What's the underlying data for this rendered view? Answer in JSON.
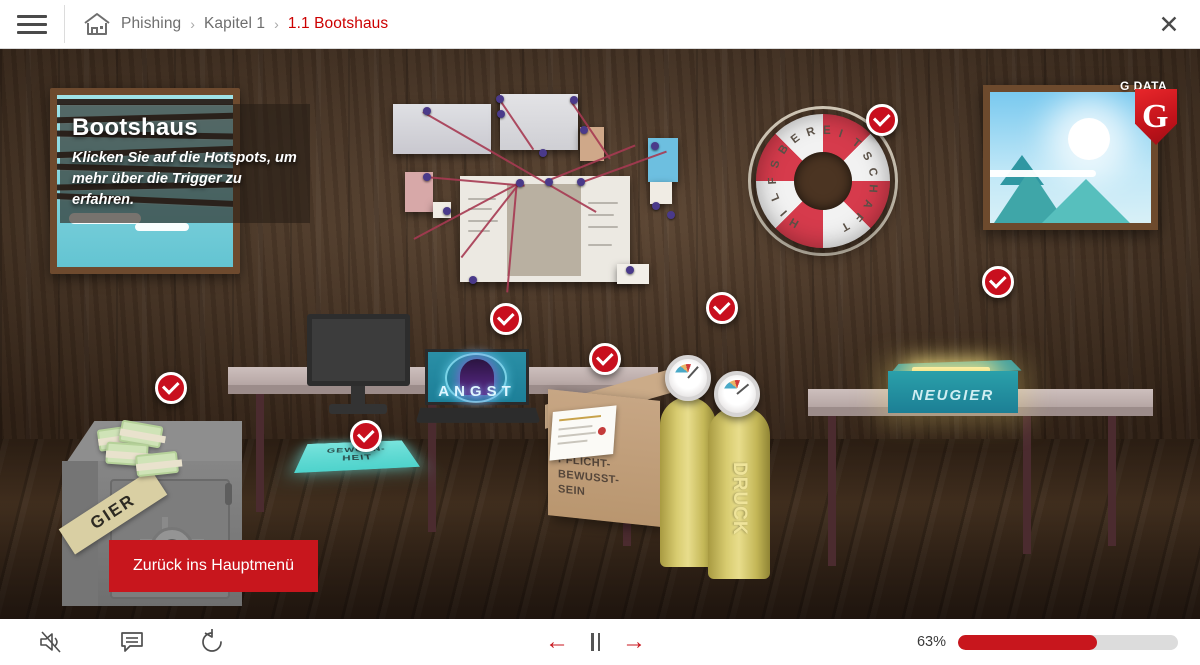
{
  "header": {
    "menu_icon": "hamburger-icon",
    "home_icon": "home-icon",
    "close_icon": "close-icon",
    "breadcrumbs": [
      {
        "label": "Phishing",
        "active": false
      },
      {
        "label": "Kapitel 1",
        "active": false
      },
      {
        "label": "1.1 Bootshaus",
        "active": true
      }
    ],
    "separator": "›"
  },
  "scene": {
    "title_card": {
      "title": "Bootshaus",
      "subtitle": "Klicken Sie auf die Hotspots, um mehr über die Trigger zu erfahren."
    },
    "brand": {
      "word": "G DATA",
      "letter": "G"
    },
    "hotspot_icon": "check-icon",
    "labels": {
      "safe": "GIER",
      "laptop": "ANGST",
      "sticky_line1": "GEWOHN-",
      "sticky_line2": "HEIT",
      "banner_line1": "PFLICHT-",
      "banner_line2": "BEWUSST-",
      "banner_line3": "SEIN",
      "cylinder": "DRUCK",
      "box": "NEUGIER",
      "lifebuoy": "HILFSBEREITSCHAFT"
    },
    "menu_button": "Zurück ins Hauptmenü"
  },
  "footer": {
    "mute_icon": "speaker-muted-icon",
    "transcript_icon": "transcript-icon",
    "replay_icon": "replay-icon",
    "prev_icon": "arrow-left-icon",
    "pause_icon": "pause-icon",
    "next_icon": "arrow-right-icon",
    "progress_label": "63%",
    "progress_value": 63
  },
  "colors": {
    "accent_red": "#c8161d",
    "crumb_active": "#cc0000",
    "wall": "#4e3725",
    "floor": "#3d2a1b"
  }
}
